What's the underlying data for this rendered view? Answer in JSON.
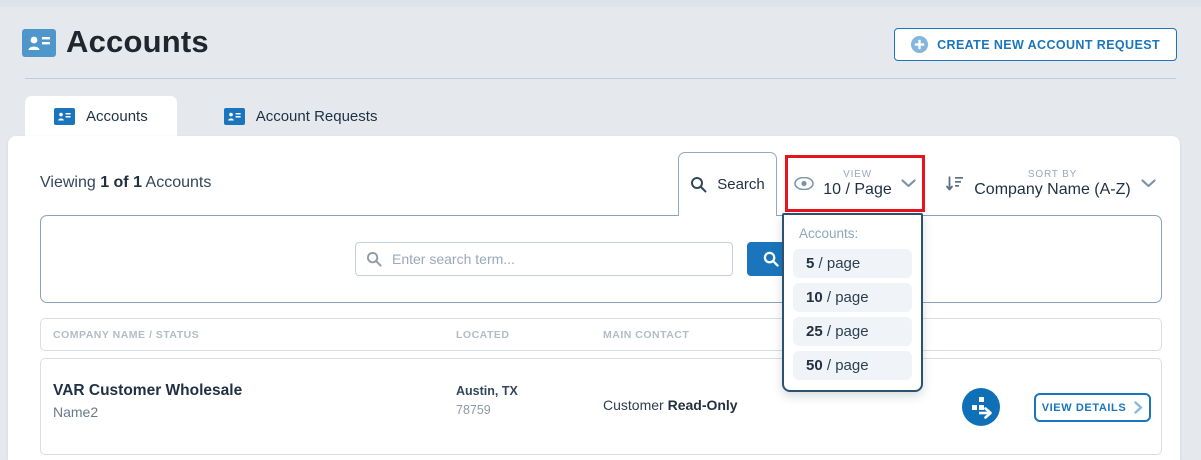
{
  "header": {
    "title": "Accounts",
    "create_button_label": "CREATE NEW ACCOUNT REQUEST"
  },
  "tabs": [
    {
      "label": "Accounts",
      "active": true
    },
    {
      "label": "Account Requests",
      "active": false
    }
  ],
  "toolbar": {
    "viewing_prefix": "Viewing ",
    "viewing_count": "1 of 1",
    "viewing_suffix": " Accounts",
    "search_tab_label": "Search",
    "view_control": {
      "label": "VIEW",
      "value": "10 / Page"
    },
    "sort_control": {
      "label": "SORT BY",
      "value": "Company Name (A-Z)"
    }
  },
  "search": {
    "placeholder": "Enter search term..."
  },
  "view_dropdown": {
    "group_label": "Accounts:",
    "options": [
      {
        "num": "5",
        "rest": " / page"
      },
      {
        "num": "10",
        "rest": " / page"
      },
      {
        "num": "25",
        "rest": " / page"
      },
      {
        "num": "50",
        "rest": " / page"
      }
    ]
  },
  "table": {
    "headers": [
      "COMPANY NAME / STATUS",
      "LOCATED",
      "MAIN CONTACT"
    ],
    "rows": [
      {
        "company": "VAR Customer Wholesale",
        "name": "Name2",
        "city": "Austin, TX",
        "zip": "78759",
        "contact_prefix": "Customer ",
        "contact_bold": "Read-Only",
        "details_button_label": "VIEW DETAILS"
      }
    ]
  },
  "colors": {
    "brand_blue": "#1b75bc",
    "header_icon_blue": "#4f97cb",
    "annotation_red": "#e8131d",
    "page_background": "#e5e9ee",
    "dropdown_border": "#2d5270",
    "option_background": "#f0f4f8",
    "muted_text": "#9aa9bb"
  }
}
